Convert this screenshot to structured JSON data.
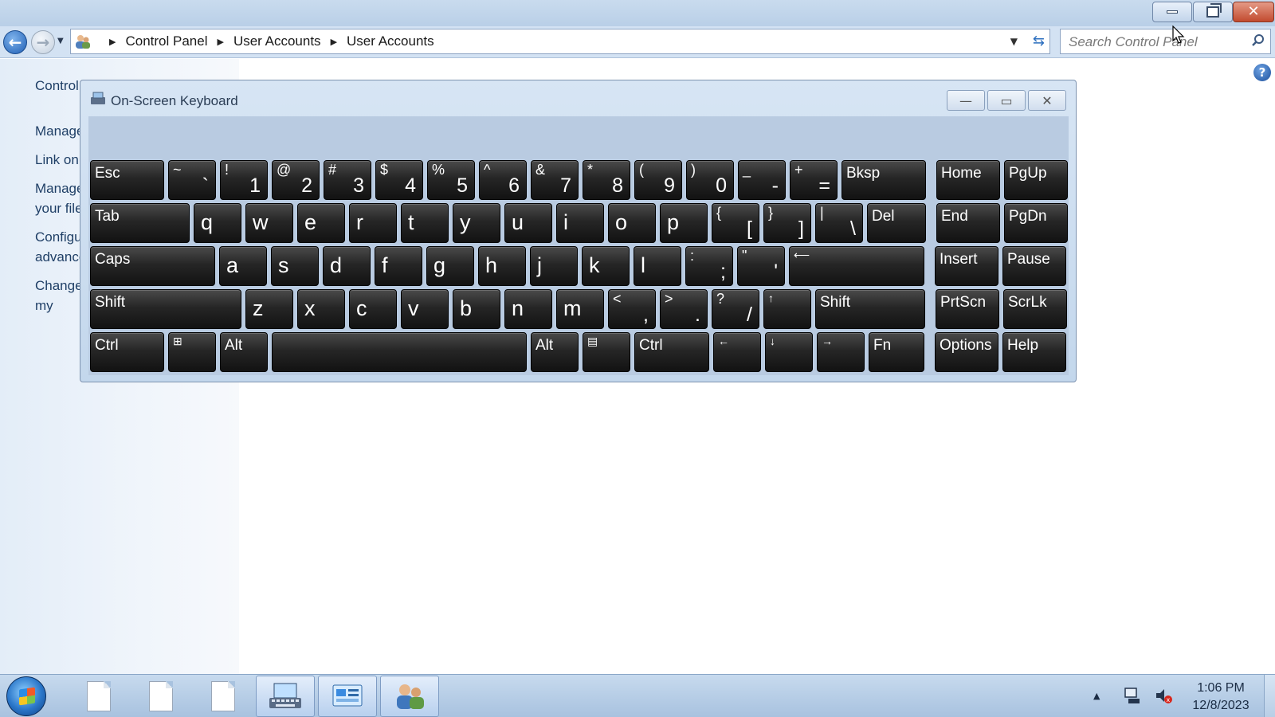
{
  "window": {
    "address": {
      "crumbs": [
        "Control Panel",
        "User Accounts",
        "User Accounts"
      ]
    },
    "search": {
      "placeholder": "Search Control Panel"
    }
  },
  "left_pane": {
    "title": "Control Panel Home",
    "links": [
      "Manage your credentials",
      "Link online IDs",
      "Manage your file encryption certificates",
      "Configure advanced user profile properties",
      "Change my environment variables"
    ]
  },
  "osk": {
    "title": "On-Screen Keyboard",
    "rows": [
      [
        {
          "id": "esc",
          "label": "Esc"
        },
        {
          "id": "tilde",
          "shift": "~",
          "base": "`"
        },
        {
          "id": "1",
          "shift": "!",
          "base": "1"
        },
        {
          "id": "2",
          "shift": "@",
          "base": "2"
        },
        {
          "id": "3",
          "shift": "#",
          "base": "3"
        },
        {
          "id": "4",
          "shift": "$",
          "base": "4"
        },
        {
          "id": "5",
          "shift": "%",
          "base": "5"
        },
        {
          "id": "6",
          "shift": "^",
          "base": "6"
        },
        {
          "id": "7",
          "shift": "&",
          "base": "7"
        },
        {
          "id": "8",
          "shift": "*",
          "base": "8"
        },
        {
          "id": "9",
          "shift": "(",
          "base": "9"
        },
        {
          "id": "0",
          "shift": ")",
          "base": "0"
        },
        {
          "id": "minus",
          "shift": "_",
          "base": "-"
        },
        {
          "id": "equals",
          "shift": "+",
          "base": "="
        },
        {
          "id": "bksp",
          "label": "Bksp"
        },
        {
          "id": "home",
          "label": "Home"
        },
        {
          "id": "pgup",
          "label": "PgUp"
        }
      ],
      [
        {
          "id": "tab",
          "label": "Tab"
        },
        {
          "id": "q",
          "char": "q"
        },
        {
          "id": "w",
          "char": "w"
        },
        {
          "id": "e",
          "char": "e"
        },
        {
          "id": "r",
          "char": "r"
        },
        {
          "id": "t",
          "char": "t"
        },
        {
          "id": "y",
          "char": "y"
        },
        {
          "id": "u",
          "char": "u"
        },
        {
          "id": "i",
          "char": "i"
        },
        {
          "id": "o",
          "char": "o"
        },
        {
          "id": "p",
          "char": "p"
        },
        {
          "id": "lbracket",
          "shift": "{",
          "base": "["
        },
        {
          "id": "rbracket",
          "shift": "}",
          "base": "]"
        },
        {
          "id": "backslash",
          "shift": "|",
          "base": "\\"
        },
        {
          "id": "del",
          "label": "Del"
        },
        {
          "id": "end",
          "label": "End"
        },
        {
          "id": "pgdn",
          "label": "PgDn"
        }
      ],
      [
        {
          "id": "caps",
          "label": "Caps"
        },
        {
          "id": "a",
          "char": "a"
        },
        {
          "id": "s",
          "char": "s"
        },
        {
          "id": "d",
          "char": "d"
        },
        {
          "id": "f",
          "char": "f"
        },
        {
          "id": "g",
          "char": "g"
        },
        {
          "id": "h",
          "char": "h"
        },
        {
          "id": "j",
          "char": "j"
        },
        {
          "id": "k",
          "char": "k"
        },
        {
          "id": "l",
          "char": "l"
        },
        {
          "id": "semicolon",
          "shift": ":",
          "base": ";"
        },
        {
          "id": "quote",
          "shift": "\"",
          "base": "'"
        },
        {
          "id": "enter",
          "label": "⟵"
        },
        {
          "id": "insert",
          "label": "Insert"
        },
        {
          "id": "pause",
          "label": "Pause"
        }
      ],
      [
        {
          "id": "lshift",
          "label": "Shift"
        },
        {
          "id": "z",
          "char": "z"
        },
        {
          "id": "x",
          "char": "x"
        },
        {
          "id": "c",
          "char": "c"
        },
        {
          "id": "v",
          "char": "v"
        },
        {
          "id": "b",
          "char": "b"
        },
        {
          "id": "n",
          "char": "n"
        },
        {
          "id": "m",
          "char": "m"
        },
        {
          "id": "comma",
          "shift": "<",
          "base": ","
        },
        {
          "id": "period",
          "shift": ">",
          "base": "."
        },
        {
          "id": "slash",
          "shift": "?",
          "base": "/"
        },
        {
          "id": "up",
          "label": "↑"
        },
        {
          "id": "rshift",
          "label": "Shift"
        },
        {
          "id": "prtscn",
          "label": "PrtScn"
        },
        {
          "id": "scrlk",
          "label": "ScrLk"
        }
      ],
      [
        {
          "id": "lctrl",
          "label": "Ctrl"
        },
        {
          "id": "win",
          "label": "⊞"
        },
        {
          "id": "lalt",
          "label": "Alt"
        },
        {
          "id": "space",
          "label": ""
        },
        {
          "id": "ralt",
          "label": "Alt"
        },
        {
          "id": "menu",
          "label": "▤"
        },
        {
          "id": "rctrl",
          "label": "Ctrl"
        },
        {
          "id": "left",
          "label": "←"
        },
        {
          "id": "down",
          "label": "↓"
        },
        {
          "id": "right",
          "label": "→"
        },
        {
          "id": "fn",
          "label": "Fn"
        },
        {
          "id": "options",
          "label": "Options"
        },
        {
          "id": "help",
          "label": "Help"
        }
      ]
    ]
  },
  "taskbar": {
    "time": "1:06 PM",
    "date": "12/8/2023"
  },
  "colors": {
    "key_face": "#262626",
    "key_text": "#ffffff",
    "osk_area": "#b9cbe1",
    "taskbar": "#b8cee6",
    "link": "#1f3f66"
  },
  "icons": {
    "back": "back-arrow-icon",
    "forward": "forward-arrow-icon",
    "refresh": "refresh-icon",
    "search": "search-icon",
    "help": "help-icon"
  }
}
